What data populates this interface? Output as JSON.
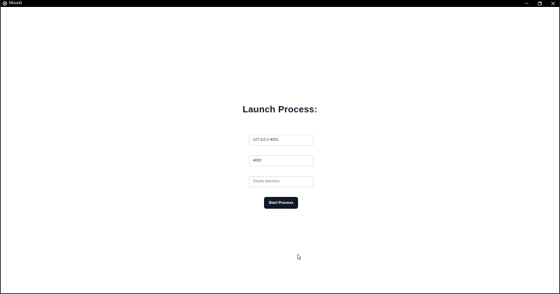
{
  "window": {
    "title": "Mound",
    "controls": {
      "minimize_icon": "minimize-icon",
      "restore_icon": "restore-icon",
      "close_icon": "close-icon"
    }
  },
  "main": {
    "heading": "Launch Process:",
    "address_input": {
      "value": "127.0.0.1:4001",
      "placeholder": ""
    },
    "port_input": {
      "value": "4003",
      "placeholder": ""
    },
    "chunk_input": {
      "value": "",
      "placeholder": "Chunk directory"
    },
    "start_button_label": "Start Process"
  },
  "colors": {
    "titlebar": "#000000",
    "button_bg": "#111827",
    "heading_text": "#111827",
    "input_border": "#e5e7eb"
  }
}
